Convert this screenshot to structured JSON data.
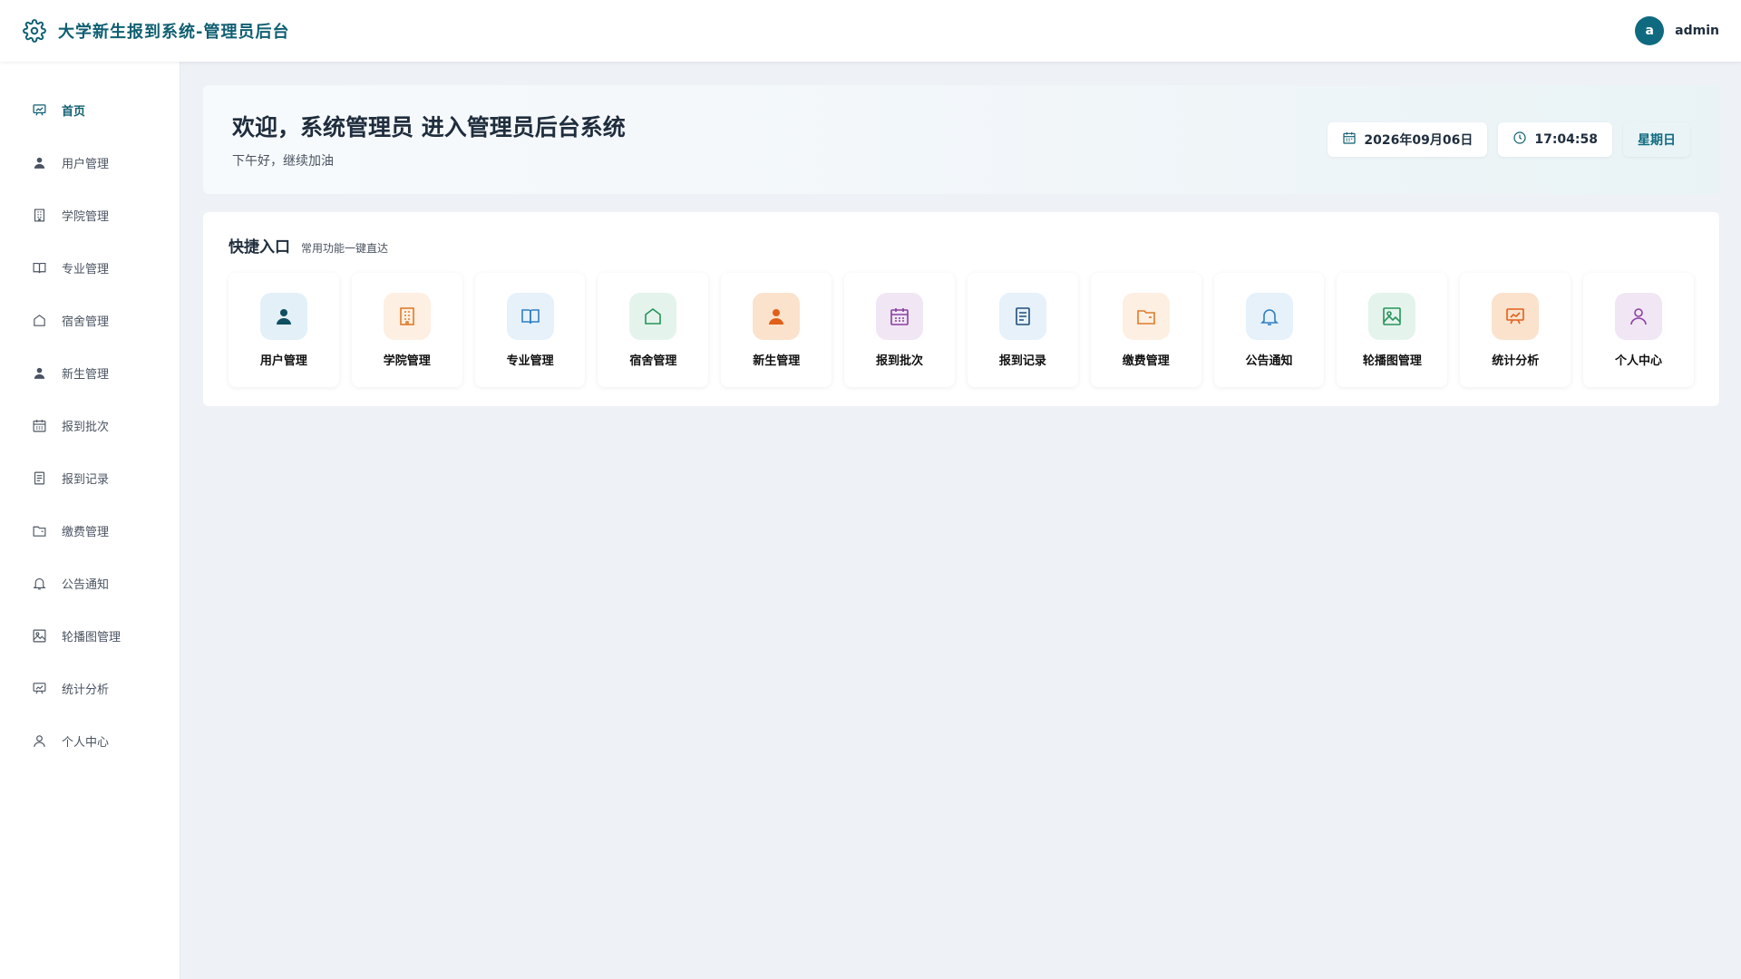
{
  "header": {
    "title": "大学新生报到系统-管理员后台",
    "avatar_letter": "a",
    "username": "admin"
  },
  "sidebar": {
    "items": [
      {
        "label": "首页",
        "icon": "dashboard-icon"
      },
      {
        "label": "用户管理",
        "icon": "user-icon"
      },
      {
        "label": "学院管理",
        "icon": "building-icon"
      },
      {
        "label": "专业管理",
        "icon": "book-icon"
      },
      {
        "label": "宿舍管理",
        "icon": "house-icon"
      },
      {
        "label": "新生管理",
        "icon": "user-icon"
      },
      {
        "label": "报到批次",
        "icon": "calendar-icon"
      },
      {
        "label": "报到记录",
        "icon": "document-icon"
      },
      {
        "label": "缴费管理",
        "icon": "wallet-icon"
      },
      {
        "label": "公告通知",
        "icon": "bell-icon"
      },
      {
        "label": "轮播图管理",
        "icon": "image-icon"
      },
      {
        "label": "统计分析",
        "icon": "chart-board-icon"
      },
      {
        "label": "个人中心",
        "icon": "user-outline-icon"
      }
    ]
  },
  "welcome": {
    "title": "欢迎，系统管理员 进入管理员后台系统",
    "subtitle": "下午好，继续加油",
    "date": "2026年09月06日",
    "time": "17:04:58",
    "weekday": "星期日"
  },
  "quick": {
    "title": "快捷入口",
    "subtitle": "常用功能一键直达",
    "items": [
      {
        "label": "用户管理",
        "icon": "user-icon",
        "bg": "#e3f0f8",
        "color": "#0f5f72"
      },
      {
        "label": "学院管理",
        "icon": "building-icon",
        "bg": "#fdefe2",
        "color": "#e07b28"
      },
      {
        "label": "专业管理",
        "icon": "book-icon",
        "bg": "#e6f1fa",
        "color": "#2f7fc1"
      },
      {
        "label": "宿舍管理",
        "icon": "house-icon",
        "bg": "#e4f4ec",
        "color": "#27935a"
      },
      {
        "label": "新生管理",
        "icon": "user-icon",
        "bg": "#fbe2cc",
        "color": "#e0601a"
      },
      {
        "label": "报到批次",
        "icon": "calendar-icon",
        "bg": "#f1e6f4",
        "color": "#8a3fa3"
      },
      {
        "label": "报到记录",
        "icon": "document-icon",
        "bg": "#e6f1fa",
        "color": "#1f4f7a"
      },
      {
        "label": "缴费管理",
        "icon": "wallet-icon",
        "bg": "#fdefe2",
        "color": "#e07b28"
      },
      {
        "label": "公告通知",
        "icon": "bell-icon",
        "bg": "#e6f1fa",
        "color": "#2f7fc1"
      },
      {
        "label": "轮播图管理",
        "icon": "image-icon",
        "bg": "#e4f4ec",
        "color": "#27935a"
      },
      {
        "label": "统计分析",
        "icon": "chart-board-icon",
        "bg": "#fbe2cc",
        "color": "#e0601a"
      },
      {
        "label": "个人中心",
        "icon": "user-outline-icon",
        "bg": "#f1e6f4",
        "color": "#8a3fa3"
      }
    ]
  },
  "colors": {
    "accent": "#0f5f72",
    "background": "#eef1f5"
  }
}
